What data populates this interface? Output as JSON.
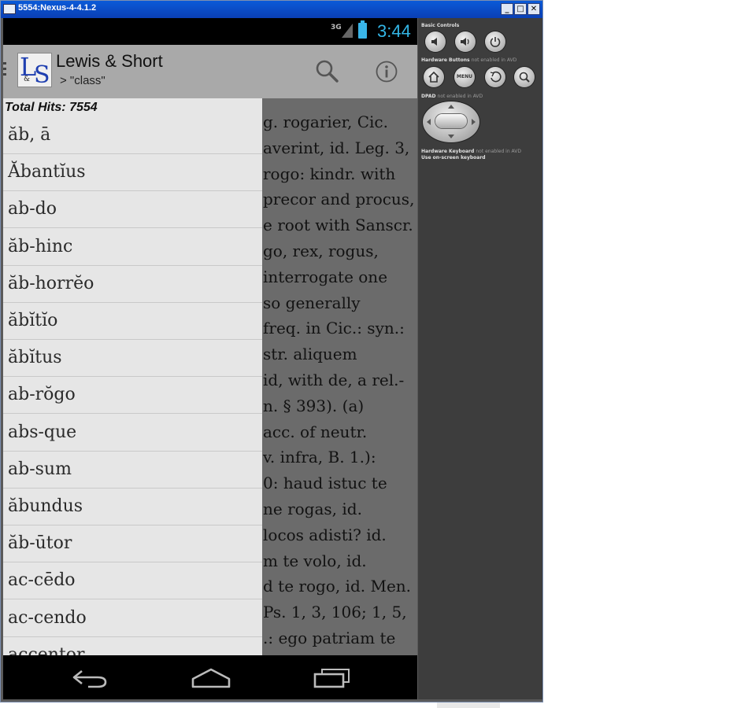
{
  "window": {
    "title": "5554:Nexus-4-4.1.2",
    "min": "_",
    "max": "□",
    "close": "✕"
  },
  "status_bar": {
    "network": "3G",
    "time": "3:44",
    "accent": "#33b5e5"
  },
  "action_bar": {
    "title": "Lewis & Short",
    "subtitle": "> \"class\"",
    "logo": {
      "letter1": "L",
      "letter2": "S",
      "amp": "&"
    },
    "search_icon": "search-icon",
    "info_icon": "info-icon"
  },
  "drawer": {
    "total_hits": "Total Hits: 7554",
    "entries": [
      "ăb, ā",
      "Ăbantĭus",
      "ab-do",
      "ăb-hinc",
      "ăb-horrĕo",
      "ăbĭtĭo",
      "ăbĭtus",
      "ab-rŏgo",
      "abs-que",
      "ab-sum",
      "ăbundus",
      "ăb-ūtor",
      "ac-cēdo",
      "ac-cendo",
      "accentor"
    ]
  },
  "definition_lines": [
    "g. rogarier, Cic.",
    "averint, id. Leg. 3,",
    "rogo: kindr. with",
    "precor and procus,",
    "e root with Sanscr.",
    "go, rex, rogus,",
    "interrogate one",
    "so generally",
    "freq. in Cic.: syn.:",
    "str. aliquem",
    "id, with de, a rel.-",
    "n. § 393). (a)",
    "acc. of neutr.",
    "v. infra, B. 1.):",
    "0: haud istuc te",
    "ne rogas, id.",
    "locos adisti? id.",
    "m te volo, id.",
    "d te rogo, id. Men.",
    "Ps. 1, 3, 106; 1, 5,",
    ".: ego patriam te"
  ],
  "nav_bar": {
    "back": "back-icon",
    "home": "home-icon",
    "recents": "recents-icon"
  },
  "emulator_panel": {
    "basic_controls": "Basic Controls",
    "hardware_buttons": "Hardware Buttons",
    "hardware_buttons_note": "not enabled in AVD",
    "dpad": "DPAD",
    "dpad_note": "not enabled in AVD",
    "hardware_keyboard": "Hardware Keyboard",
    "hardware_keyboard_note": "not enabled in AVD",
    "onscreen_keyboard": "Use on-screen keyboard",
    "menu_label": "MENU"
  }
}
